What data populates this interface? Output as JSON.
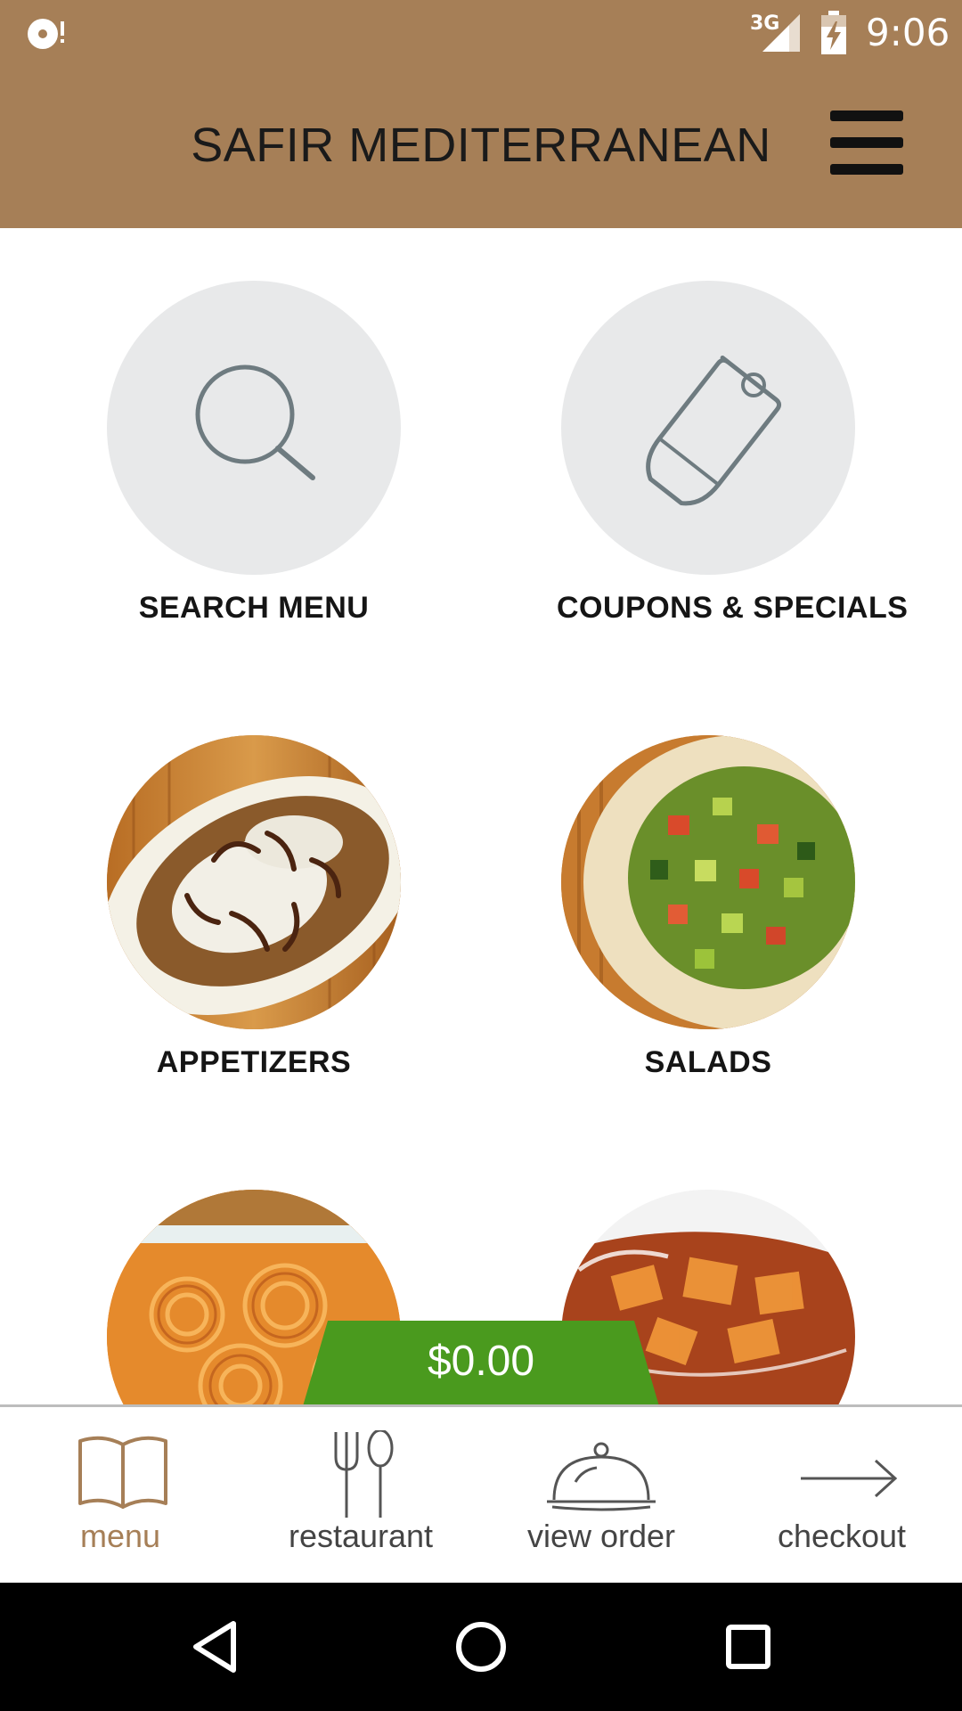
{
  "status_bar": {
    "network": "3G",
    "time": "9:06"
  },
  "header": {
    "title": "SAFIR MEDITERRANEAN"
  },
  "tiles": [
    {
      "label": "SEARCH MENU",
      "icon": "search-icon"
    },
    {
      "label": "COUPONS & SPECIALS",
      "icon": "tag-icon"
    },
    {
      "label": "APPETIZERS",
      "image": "appetizer-photo"
    },
    {
      "label": "SALADS",
      "image": "salad-photo"
    },
    {
      "label": "",
      "image": "dessert-photo"
    },
    {
      "label": "",
      "image": "drinks-photo"
    }
  ],
  "cart": {
    "total": "$0.00"
  },
  "bottom_nav": {
    "items": [
      {
        "label": "menu",
        "icon": "book-icon",
        "active": true
      },
      {
        "label": "restaurant",
        "icon": "fork-spoon-icon",
        "active": false
      },
      {
        "label": "view order",
        "icon": "cloche-icon",
        "active": false
      },
      {
        "label": "checkout",
        "icon": "arrow-right-icon",
        "active": false
      }
    ]
  },
  "colors": {
    "brand": "#A67F57",
    "cart_green": "#4A9A1E",
    "circle_gray": "#E8E9EA",
    "icon_gray": "#6E7B80"
  }
}
